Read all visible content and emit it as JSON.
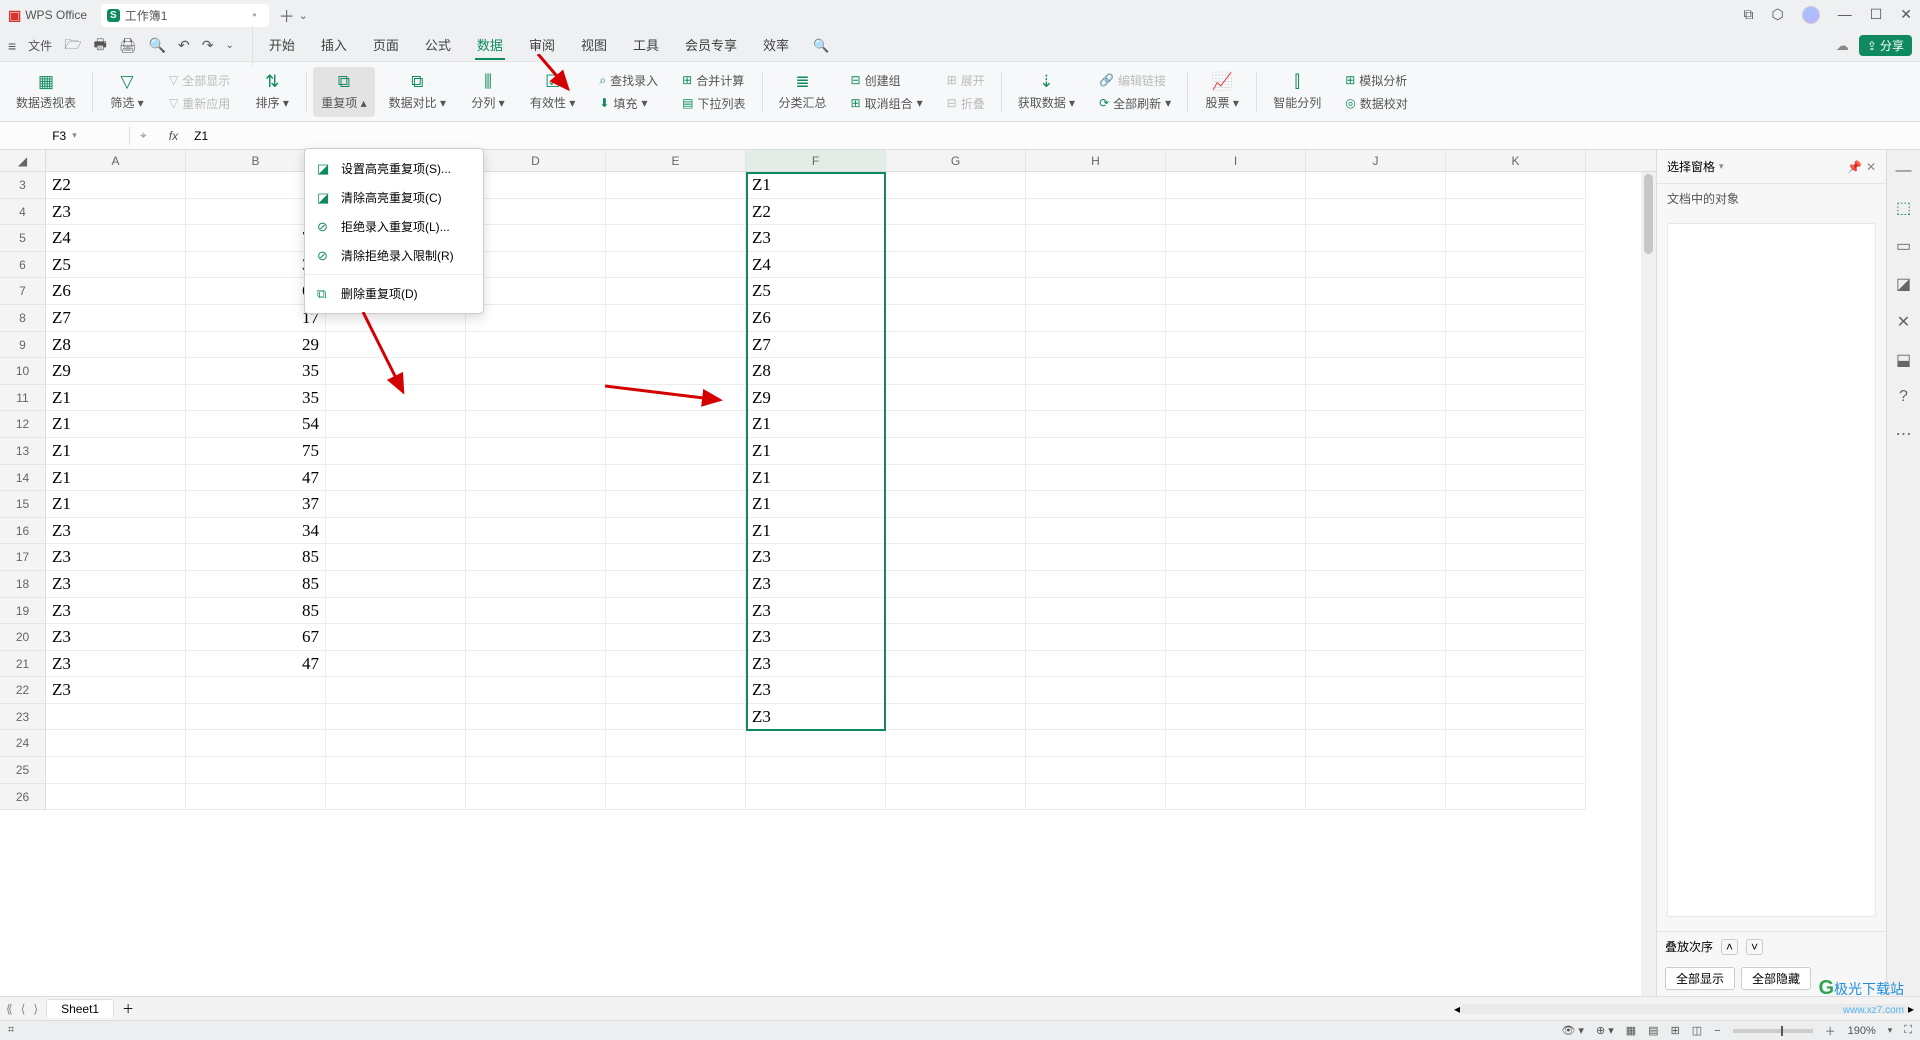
{
  "title": {
    "wps": "WPS Office",
    "doc": "工作簿1"
  },
  "menutabs": [
    "开始",
    "插入",
    "页面",
    "公式",
    "数据",
    "审阅",
    "视图",
    "工具",
    "会员专享",
    "效率"
  ],
  "activeMenu": "数据",
  "fileLabel": "文件",
  "ribbon": {
    "pivot": "数据透视表",
    "filter": "筛选",
    "showall": "全部显示",
    "reapply": "重新应用",
    "sort": "排序",
    "dup": "重复项",
    "compare": "数据对比",
    "split": "分列",
    "valid": "有效性",
    "fill": "填充",
    "dropcol": "下拉列表",
    "lookup": "查找录入",
    "consol": "合并计算",
    "subtotal": "分类汇总",
    "group": "创建组",
    "ungroup": "取消组合",
    "expand": "展开",
    "collapse": "折叠",
    "getdata": "获取数据",
    "refreshall": "全部刷新",
    "editlink": "编辑链接",
    "stock": "股票",
    "smart": "智能分列",
    "sim": "模拟分析",
    "dvalid": "数据校对"
  },
  "namebox": "F3",
  "fx_label": "fx",
  "formula": "Z1",
  "cols": [
    "A",
    "B",
    "C",
    "D",
    "E",
    "F",
    "G",
    "H",
    "I",
    "J",
    "K"
  ],
  "rowStart": 3,
  "rowCount": 24,
  "colA": [
    "Z2",
    "Z3",
    "Z4",
    "Z5",
    "Z6",
    "Z7",
    "Z8",
    "Z9",
    "Z1",
    "Z1",
    "Z1",
    "Z1",
    "Z1",
    "Z3",
    "Z3",
    "Z3",
    "Z3",
    "Z3",
    "Z3",
    "Z3",
    "",
    "",
    ""
  ],
  "colB": [
    "",
    "",
    "76",
    "34",
    "68",
    "17",
    "29",
    "35",
    "35",
    "54",
    "75",
    "47",
    "37",
    "34",
    "85",
    "85",
    "85",
    "67",
    "47",
    "",
    "",
    "",
    ""
  ],
  "colF": [
    "Z1",
    "Z2",
    "Z3",
    "Z4",
    "Z5",
    "Z6",
    "Z7",
    "Z8",
    "Z9",
    "Z1",
    "Z1",
    "Z1",
    "Z1",
    "Z1",
    "Z3",
    "Z3",
    "Z3",
    "Z3",
    "Z3",
    "Z3",
    "Z3",
    "",
    ""
  ],
  "dropdown": [
    {
      "icon": "◪",
      "label": "设置高亮重复项(S)...",
      "shortcut": "S"
    },
    {
      "icon": "◪",
      "label": "清除高亮重复项(C)",
      "shortcut": "C"
    },
    {
      "icon": "⊘",
      "label": "拒绝录入重复项(L)...",
      "shortcut": "L"
    },
    {
      "icon": "⊘",
      "label": "清除拒绝录入限制(R)",
      "shortcut": "R"
    },
    {
      "sep": true
    },
    {
      "icon": "⧉",
      "label": "删除重复项(D)",
      "shortcut": "D"
    }
  ],
  "panel": {
    "title": "选择窗格",
    "sub": "文档中的对象",
    "order": "叠放次序",
    "showall": "全部显示",
    "hideall": "全部隐藏"
  },
  "sheet": "Sheet1",
  "zoom": "190%",
  "share": "分享",
  "watermark": {
    "brand": "极光下载站",
    "url": "www.xz7.com"
  }
}
